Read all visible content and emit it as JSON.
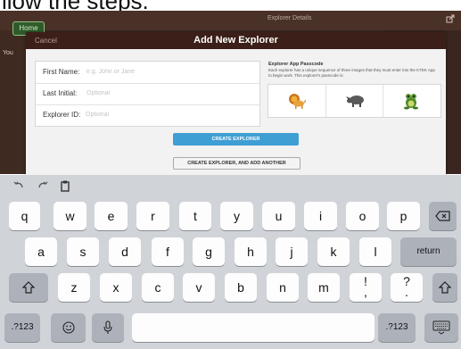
{
  "caption": {
    "text": "llow the steps."
  },
  "app": {
    "home_label": "Home",
    "header_title": "Explorer Details",
    "side_text": "You"
  },
  "modal": {
    "cancel_label": "Cancel",
    "title": "Add New Explorer",
    "fields": [
      {
        "label": "First Name:",
        "placeholder": "e.g. John or Jane",
        "value": ""
      },
      {
        "label": "Last Initial:",
        "placeholder": "Optional",
        "value": ""
      },
      {
        "label": "Explorer ID:",
        "placeholder": "Optional",
        "value": ""
      }
    ],
    "passcode": {
      "title": "Explorer App Passcode",
      "description": "Each explorer has a unique sequence of three images that they must enter into the KTEK App to begin work. This explorer's passcode is:",
      "icons": [
        "lion-icon",
        "rhino-icon",
        "frog-icon"
      ]
    },
    "create_label": "CREATE EXPLORER",
    "create_another_label": "CREATE EXPLORER, AND ADD ANOTHER"
  },
  "keyboard": {
    "toolbar_icons": [
      "undo-icon",
      "redo-icon",
      "paste-icon"
    ],
    "row1": [
      "q",
      "w",
      "e",
      "r",
      "t",
      "y",
      "u",
      "i",
      "o",
      "p"
    ],
    "row2": [
      "a",
      "s",
      "d",
      "f",
      "g",
      "h",
      "j",
      "k",
      "l"
    ],
    "return_label": "return",
    "row3": [
      "z",
      "x",
      "c",
      "v",
      "b",
      "n",
      "m"
    ],
    "punct1": {
      "top": "!",
      "bottom": ","
    },
    "punct2": {
      "top": "?",
      "bottom": "."
    },
    "numbers_label": ".?123",
    "icons": [
      "delete-icon",
      "shift-icon",
      "emoji-icon",
      "microphone-icon",
      "keyboard-dismiss-icon"
    ]
  },
  "colors": {
    "app_background": "#3f2a22",
    "modal_header": "#3b1f18",
    "primary_button": "#3f9ed4",
    "keyboard_background": "#d0d3d8"
  }
}
